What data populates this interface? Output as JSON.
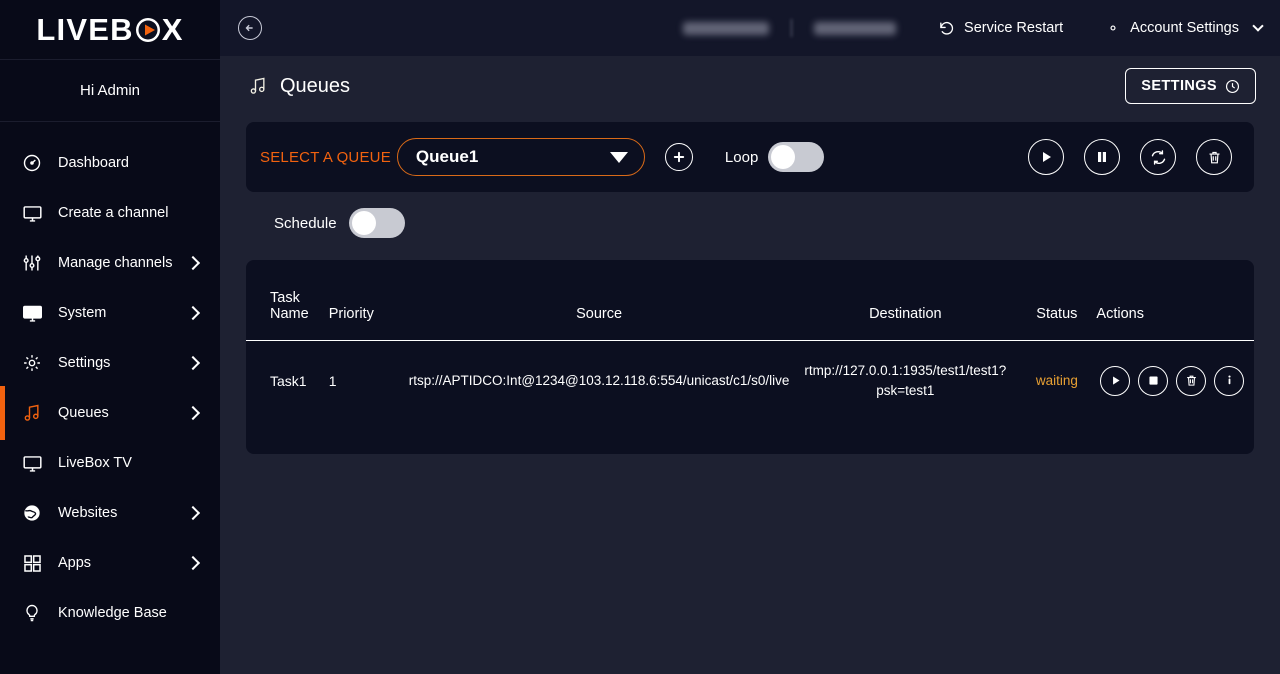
{
  "brand": {
    "name_part1": "LIVEB",
    "name_part2": "X",
    "greeting": "Hi Admin"
  },
  "sidebar": {
    "items": [
      {
        "label": "Dashboard",
        "icon": "gauge-icon",
        "chevron": false,
        "active": false
      },
      {
        "label": "Create a channel",
        "icon": "monitor-icon",
        "chevron": false,
        "active": false
      },
      {
        "label": "Manage channels",
        "icon": "sliders-icon",
        "chevron": true,
        "active": false
      },
      {
        "label": "System",
        "icon": "desktop-icon",
        "chevron": true,
        "active": false
      },
      {
        "label": "Settings",
        "icon": "gear-icon",
        "chevron": true,
        "active": false
      },
      {
        "label": "Queues",
        "icon": "music-note-icon",
        "chevron": true,
        "active": true
      },
      {
        "label": "LiveBox TV",
        "icon": "tv-icon",
        "chevron": false,
        "active": false
      },
      {
        "label": "Websites",
        "icon": "globe-icon",
        "chevron": true,
        "active": false
      },
      {
        "label": "Apps",
        "icon": "grid-icon",
        "chevron": true,
        "active": false
      },
      {
        "label": "Knowledge Base",
        "icon": "bulb-icon",
        "chevron": false,
        "active": false
      }
    ]
  },
  "topbar": {
    "back_icon": "arrow-left-circle-icon",
    "redacted_left": "",
    "redacted_right": "",
    "service_restart": "Service Restart",
    "service_restart_icon": "restart-icon",
    "account_settings": "Account Settings",
    "account_settings_icon": "gear-icon"
  },
  "page": {
    "title": "Queues",
    "title_icon": "music-note-icon",
    "settings_button": "SETTINGS",
    "settings_button_icon": "clock-icon"
  },
  "queue_panel": {
    "select_label": "SELECT A QUEUE",
    "selected_queue": "Queue1",
    "dropdown_icon": "caret-down-icon",
    "add_icon": "plus-icon",
    "loop_label": "Loop",
    "loop_on": false,
    "actions": [
      {
        "name": "play-button",
        "icon": "play-icon"
      },
      {
        "name": "pause-button",
        "icon": "pause-icon"
      },
      {
        "name": "refresh-button",
        "icon": "refresh-icon"
      },
      {
        "name": "delete-button",
        "icon": "trash-icon"
      }
    ]
  },
  "schedule": {
    "label": "Schedule",
    "on": false
  },
  "table": {
    "columns": [
      "Task Name",
      "Priority",
      "Source",
      "Destination",
      "Status",
      "Actions"
    ],
    "col_task_line1": "Task",
    "col_task_line2": "Name",
    "col_priority": "Priority",
    "col_source": "Source",
    "col_destination": "Destination",
    "col_status": "Status",
    "col_actions": "Actions",
    "rows": [
      {
        "task_name": "Task1",
        "priority": "1",
        "source": "rtsp://APTIDCO:Int@1234@103.12.118.6:554/unicast/c1/s0/live",
        "destination": "rtmp://127.0.0.1:1935/test1/test1?psk=test1",
        "status": "waiting",
        "actions": [
          "play-icon",
          "stop-icon",
          "trash-icon",
          "info-icon"
        ]
      }
    ]
  },
  "colors": {
    "accent": "#f2620f",
    "sidebar_bg": "#080a18",
    "main_bg": "#1e2132",
    "panel_bg": "#0c0f20",
    "topbar_bg": "#131629",
    "status_waiting": "#e8a033"
  }
}
